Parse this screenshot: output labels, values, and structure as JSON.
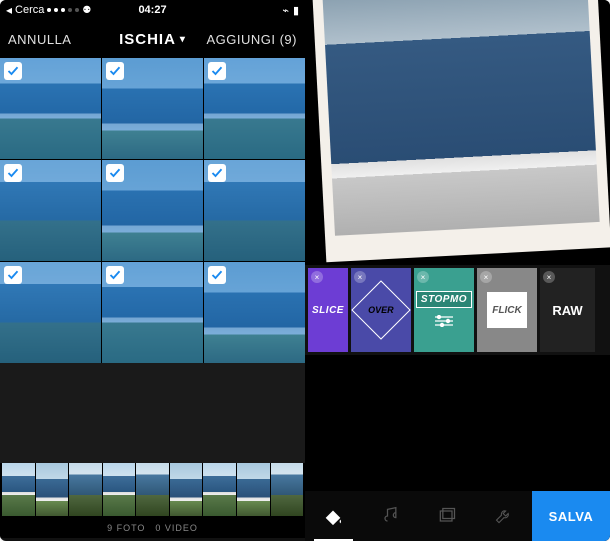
{
  "statusbar": {
    "back": "Cerca",
    "time": "04:27"
  },
  "titlebar": {
    "cancel": "ANNULLA",
    "title": "ISCHIA",
    "add": "AGGIUNGI (9)"
  },
  "grid": {
    "cells": [
      {
        "selected": true
      },
      {
        "selected": true
      },
      {
        "selected": true
      },
      {
        "selected": true
      },
      {
        "selected": true
      },
      {
        "selected": true
      },
      {
        "selected": true
      },
      {
        "selected": true
      },
      {
        "selected": true
      }
    ]
  },
  "footer": {
    "photos": "9 FOTO",
    "videos": "0 VIDEO"
  },
  "effects": {
    "slice": "SLICE",
    "over": "OVER",
    "stopmo": "STOPMO",
    "flick": "FLICK",
    "raw": "RAW"
  },
  "bottombar": {
    "save": "SALVA"
  }
}
